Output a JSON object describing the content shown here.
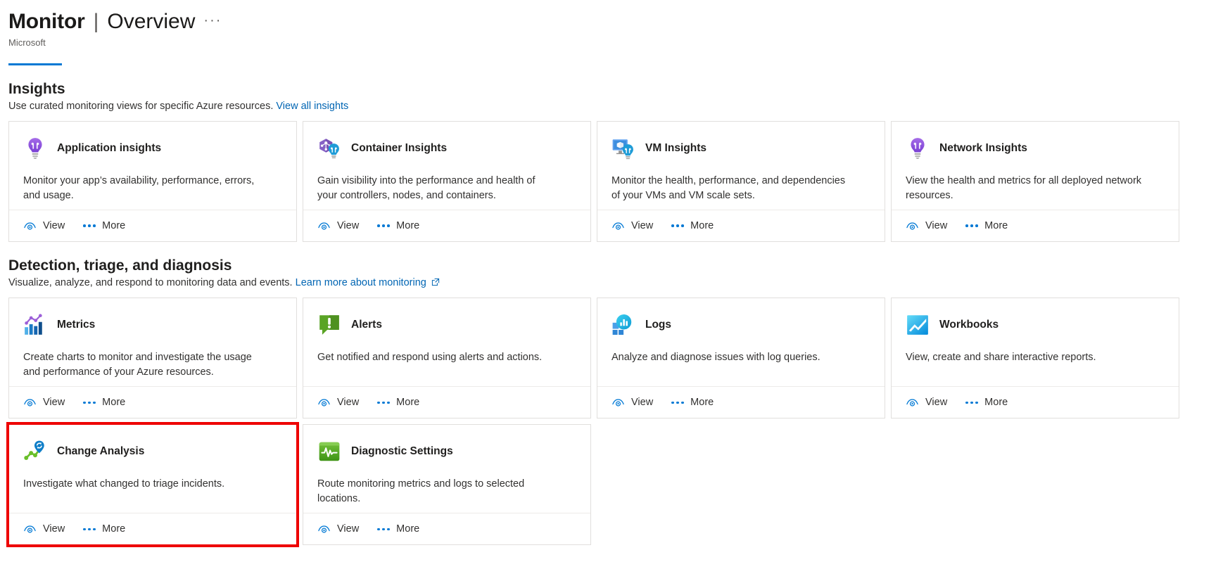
{
  "header": {
    "title_main": "Monitor",
    "title_separator": "|",
    "title_sub": "Overview",
    "ellipsis": "···",
    "subtitle": "Microsoft",
    "accent_color": "#0078d4"
  },
  "sections": [
    {
      "id": "insights",
      "title": "Insights",
      "desc_text": "Use curated monitoring views for specific Azure resources.",
      "link_label": "View all insights",
      "link_external": false,
      "cards": [
        {
          "id": "application-insights",
          "title": "Application insights",
          "desc": "Monitor your app’s availability, performance, errors, and usage.",
          "icon": "lightbulb-purple-icon",
          "view_label": "View",
          "more_label": "More",
          "highlighted": false
        },
        {
          "id": "container-insights",
          "title": "Container Insights",
          "desc": "Gain visibility into the performance and health of your controllers, nodes, and containers.",
          "icon": "container-lightbulb-icon",
          "view_label": "View",
          "more_label": "More",
          "highlighted": false
        },
        {
          "id": "vm-insights",
          "title": "VM Insights",
          "desc": "Monitor the health, performance, and dependencies of your VMs and VM scale sets.",
          "icon": "vm-lightbulb-icon",
          "view_label": "View",
          "more_label": "More",
          "highlighted": false
        },
        {
          "id": "network-insights",
          "title": "Network Insights",
          "desc": "View the health and metrics for all deployed network resources.",
          "icon": "lightbulb-purple-icon",
          "view_label": "View",
          "more_label": "More",
          "highlighted": false
        }
      ]
    },
    {
      "id": "detection-triage-diagnosis",
      "title": "Detection, triage, and diagnosis",
      "desc_text": "Visualize, analyze, and respond to monitoring data and events.",
      "link_label": "Learn more about monitoring",
      "link_external": true,
      "cards": [
        {
          "id": "metrics",
          "title": "Metrics",
          "desc": "Create charts to monitor and investigate the usage and performance of your Azure resources.",
          "icon": "metrics-chart-icon",
          "view_label": "View",
          "more_label": "More",
          "highlighted": false
        },
        {
          "id": "alerts",
          "title": "Alerts",
          "desc": "Get notified and respond using alerts and actions.",
          "icon": "alert-bubble-icon",
          "view_label": "View",
          "more_label": "More",
          "highlighted": false
        },
        {
          "id": "logs",
          "title": "Logs",
          "desc": "Analyze and diagnose issues with log queries.",
          "icon": "logs-icon",
          "view_label": "View",
          "more_label": "More",
          "highlighted": false
        },
        {
          "id": "workbooks",
          "title": "Workbooks",
          "desc": "View, create and share interactive reports.",
          "icon": "workbooks-icon",
          "view_label": "View",
          "more_label": "More",
          "highlighted": false
        },
        {
          "id": "change-analysis",
          "title": "Change Analysis",
          "desc": "Investigate what changed to triage incidents.",
          "icon": "change-analysis-icon",
          "view_label": "View",
          "more_label": "More",
          "highlighted": true,
          "highlight_color": "#ee0000"
        },
        {
          "id": "diagnostic-settings",
          "title": "Diagnostic Settings",
          "desc": "Route monitoring metrics and logs to selected locations.",
          "icon": "diagnostic-settings-icon",
          "view_label": "View",
          "more_label": "More",
          "highlighted": false
        }
      ]
    }
  ]
}
